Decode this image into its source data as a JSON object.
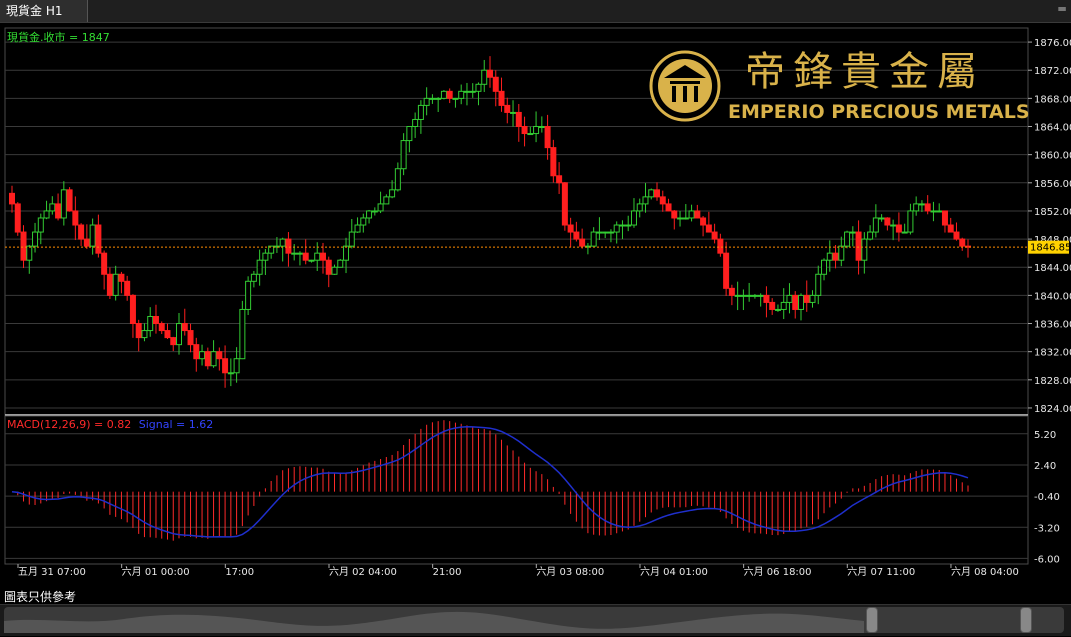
{
  "tab": {
    "label": "現貨金 H1"
  },
  "price_header": "現貨金.收市 = 1847",
  "macd_header": {
    "label": "MACD(12,26,9) = 0.82",
    "signal": "Signal = 1.62"
  },
  "brand": {
    "chinese": "帝鋒貴金屬",
    "english": "EMPERIO PRECIOUS METALS",
    "gold": "#d9b24a"
  },
  "current_price_label": "1846.85",
  "disclaimer": "圖表只供參考",
  "colors": {
    "up": "#33cc33",
    "down": "#ff1f1f",
    "signal": "#1f2fcc",
    "grid": "#3a3a3a",
    "price_line": "#ff8c00"
  },
  "chart_data": [
    {
      "type": "candlestick",
      "title": "現貨金 H1",
      "y_ticks": [
        "1876.00",
        "1872.00",
        "1868.00",
        "1864.00",
        "1860.00",
        "1856.00",
        "1852.00",
        "1848.00",
        "1844.00",
        "1840.00",
        "1836.00",
        "1832.00",
        "1828.00",
        "1824.00"
      ],
      "ylim": [
        1823,
        1878
      ],
      "x_tick_labels": [
        "五月 31 07:00",
        "六月 01 00:00",
        "17:00",
        "六月 02 04:00",
        "21:00",
        "六月 03 08:00",
        "六月 04 01:00",
        "六月 06 18:00",
        "六月 07 11:00",
        "六月 08 04:00"
      ],
      "last_price": 1846.85,
      "close": [
        1853,
        1849,
        1845,
        1847,
        1849,
        1851,
        1852,
        1853,
        1851,
        1855,
        1852,
        1850,
        1848,
        1847,
        1850,
        1846,
        1843,
        1840,
        1843,
        1842,
        1840,
        1836,
        1834,
        1835,
        1837,
        1836,
        1835,
        1834,
        1833,
        1836,
        1835,
        1833,
        1831,
        1832,
        1830,
        1832,
        1831,
        1829,
        1829,
        1831,
        1838,
        1842,
        1843,
        1845,
        1846,
        1847,
        1847,
        1848,
        1846,
        1846,
        1846,
        1845,
        1845,
        1846,
        1845,
        1843,
        1844,
        1845,
        1847,
        1849,
        1850,
        1851,
        1852,
        1852,
        1853,
        1854,
        1855,
        1858,
        1862,
        1864,
        1865,
        1867,
        1868,
        1868,
        1868,
        1869,
        1868,
        1868,
        1869,
        1869,
        1869,
        1870,
        1872,
        1871,
        1869,
        1867,
        1866,
        1866,
        1864,
        1863,
        1863,
        1864,
        1864,
        1861,
        1857,
        1856,
        1850,
        1849,
        1848,
        1847,
        1847,
        1849,
        1849,
        1849,
        1849,
        1850,
        1850,
        1850,
        1852,
        1853,
        1854,
        1855,
        1854,
        1853,
        1852,
        1851,
        1851,
        1851,
        1852,
        1851,
        1850,
        1849,
        1848,
        1846,
        1841,
        1840,
        1840,
        1840,
        1840,
        1840,
        1840,
        1839,
        1838,
        1838,
        1839,
        1840,
        1838,
        1840,
        1839,
        1840,
        1843,
        1845,
        1846,
        1845,
        1847,
        1849,
        1849,
        1845,
        1848,
        1849,
        1851,
        1851,
        1850,
        1850,
        1849,
        1849,
        1852,
        1853,
        1853,
        1852,
        1852,
        1852,
        1850,
        1849,
        1848,
        1847,
        1846.85
      ],
      "volatility_note": "approximate hourly candles"
    },
    {
      "type": "bar",
      "title": "MACD(12,26,9) = 0.82",
      "series": [
        {
          "name": "MACD(12,26,9)",
          "value": 0.82
        },
        {
          "name": "Signal",
          "value": 1.62
        }
      ],
      "y_ticks": [
        "5.20",
        "2.40",
        "-0.40",
        "-3.20",
        "-6.00"
      ],
      "ylim": [
        -6.5,
        6.8
      ]
    }
  ]
}
